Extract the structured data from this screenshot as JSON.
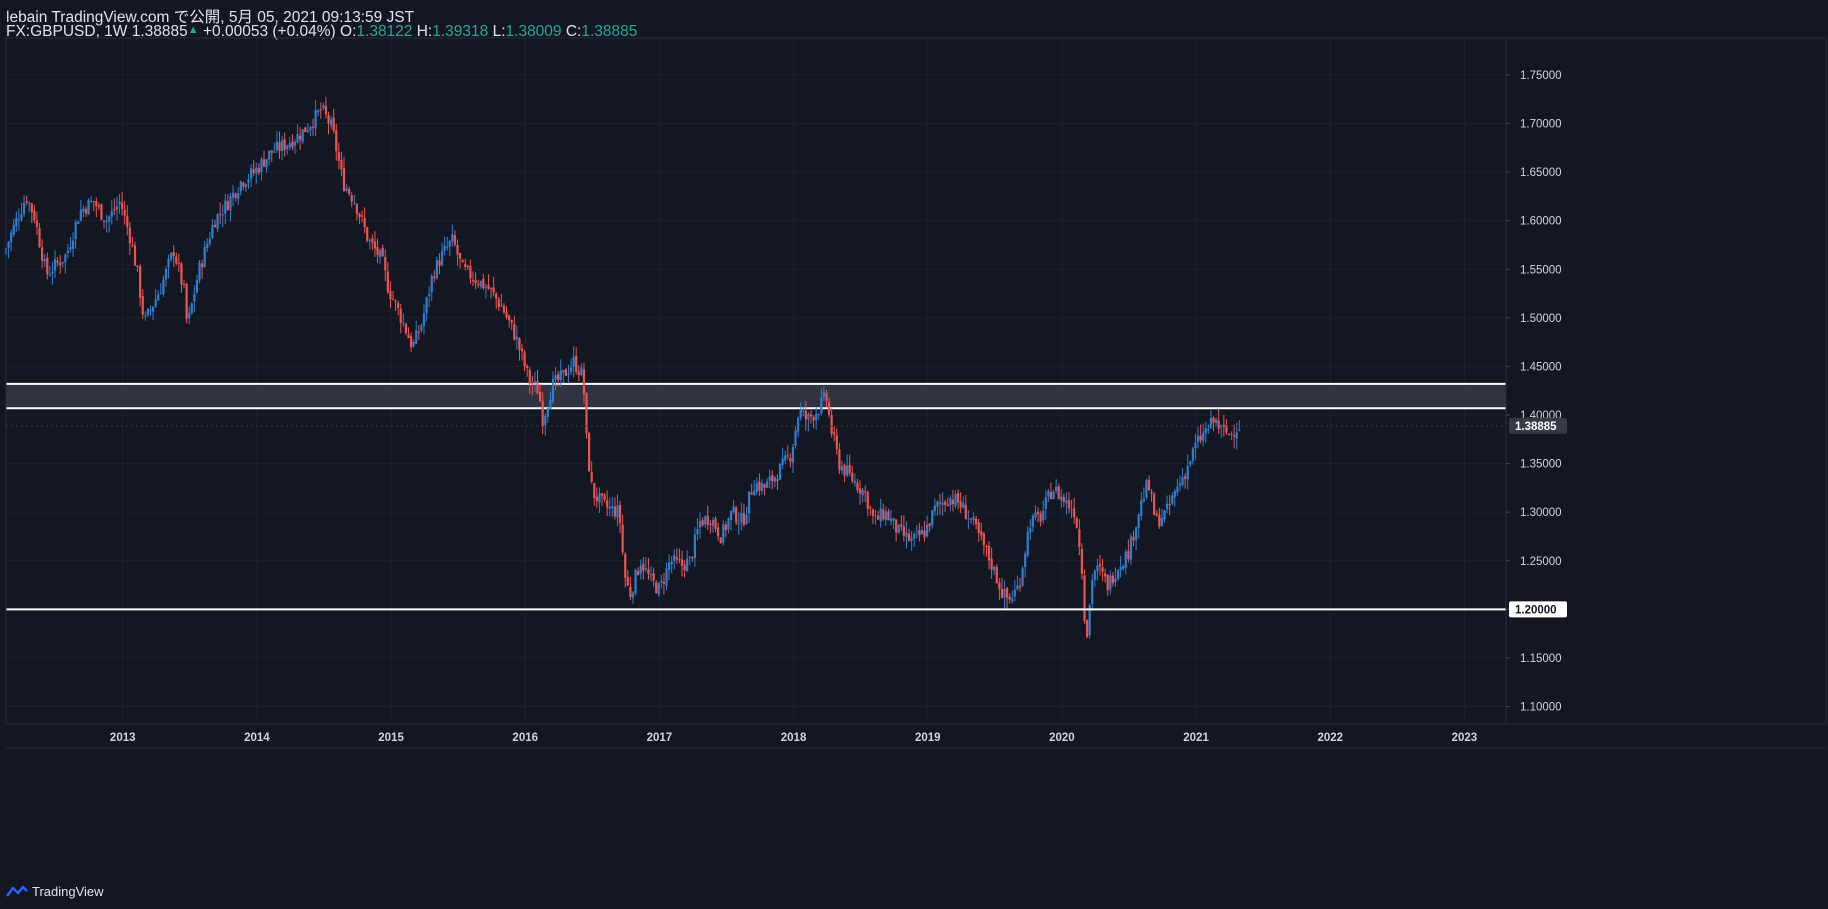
{
  "header": {
    "line1": "lebain TradingView.com で公開, 5月 05, 2021 09:13:59 JST",
    "symbol": "FX:GBPUSD, 1W",
    "last": "1.38885",
    "change": "+0.00053 (+0.04%)",
    "o_label": "O:",
    "o_value": "1.38122",
    "h_label": "H:",
    "h_value": "1.39318",
    "l_label": "L:",
    "l_value": "1.38009",
    "c_label": "C:",
    "c_value": "1.38885"
  },
  "footer": {
    "brand": "TradingView"
  },
  "colors": {
    "background": "#131722",
    "up": "#2f7fd1",
    "down": "#ef5350",
    "zone": "#363a45",
    "line": "#ffffff",
    "text": "#d1d4dc",
    "accent": "#26a69a"
  },
  "chart_data": {
    "type": "candlestick",
    "symbol": "FX:GBPUSD",
    "interval": "1W",
    "x_ticks": [
      "2013",
      "2014",
      "2015",
      "2016",
      "2017",
      "2018",
      "2019",
      "2020",
      "2021",
      "2022",
      "2023"
    ],
    "y_ticks": [
      "1.75000",
      "1.70000",
      "1.65000",
      "1.60000",
      "1.55000",
      "1.50000",
      "1.45000",
      "1.40000",
      "1.35000",
      "1.30000",
      "1.25000",
      "1.20000",
      "1.15000",
      "1.10000"
    ],
    "ylim": [
      1.082,
      1.788
    ],
    "xlim": [
      2012.13,
      2023.31
    ],
    "last_price_label": "1.38885",
    "horizontal_levels": [
      {
        "price": 1.2,
        "label": "1.20000"
      }
    ],
    "zone": {
      "low": 1.407,
      "high": 1.432
    },
    "series_path": [
      [
        2012.13,
        1.565
      ],
      [
        2012.22,
        1.598
      ],
      [
        2012.3,
        1.625
      ],
      [
        2012.36,
        1.605
      ],
      [
        2012.45,
        1.545
      ],
      [
        2012.6,
        1.565
      ],
      [
        2012.7,
        1.61
      ],
      [
        2012.8,
        1.62
      ],
      [
        2012.9,
        1.6
      ],
      [
        2013.0,
        1.62
      ],
      [
        2013.08,
        1.58
      ],
      [
        2013.13,
        1.545
      ],
      [
        2013.18,
        1.495
      ],
      [
        2013.3,
        1.53
      ],
      [
        2013.4,
        1.57
      ],
      [
        2013.48,
        1.525
      ],
      [
        2013.5,
        1.49
      ],
      [
        2013.58,
        1.545
      ],
      [
        2013.7,
        1.6
      ],
      [
        2013.8,
        1.618
      ],
      [
        2013.9,
        1.64
      ],
      [
        2014.0,
        1.65
      ],
      [
        2014.12,
        1.67
      ],
      [
        2014.25,
        1.68
      ],
      [
        2014.35,
        1.69
      ],
      [
        2014.45,
        1.705
      ],
      [
        2014.5,
        1.715
      ],
      [
        2014.58,
        1.695
      ],
      [
        2014.66,
        1.64
      ],
      [
        2014.75,
        1.62
      ],
      [
        2014.85,
        1.58
      ],
      [
        2014.95,
        1.56
      ],
      [
        2015.0,
        1.53
      ],
      [
        2015.08,
        1.505
      ],
      [
        2015.18,
        1.47
      ],
      [
        2015.25,
        1.495
      ],
      [
        2015.33,
        1.545
      ],
      [
        2015.4,
        1.565
      ],
      [
        2015.48,
        1.58
      ],
      [
        2015.55,
        1.55
      ],
      [
        2015.65,
        1.54
      ],
      [
        2015.75,
        1.53
      ],
      [
        2015.85,
        1.51
      ],
      [
        2015.95,
        1.48
      ],
      [
        2016.05,
        1.435
      ],
      [
        2016.12,
        1.425
      ],
      [
        2016.15,
        1.395
      ],
      [
        2016.22,
        1.43
      ],
      [
        2016.3,
        1.44
      ],
      [
        2016.38,
        1.455
      ],
      [
        2016.45,
        1.44
      ],
      [
        2016.48,
        1.365
      ],
      [
        2016.52,
        1.32
      ],
      [
        2016.62,
        1.305
      ],
      [
        2016.72,
        1.3
      ],
      [
        2016.76,
        1.235
      ],
      [
        2016.8,
        1.215
      ],
      [
        2016.88,
        1.25
      ],
      [
        2016.95,
        1.23
      ],
      [
        2017.02,
        1.22
      ],
      [
        2017.1,
        1.25
      ],
      [
        2017.18,
        1.245
      ],
      [
        2017.25,
        1.25
      ],
      [
        2017.32,
        1.29
      ],
      [
        2017.4,
        1.295
      ],
      [
        2017.48,
        1.275
      ],
      [
        2017.56,
        1.3
      ],
      [
        2017.64,
        1.29
      ],
      [
        2017.72,
        1.33
      ],
      [
        2017.8,
        1.325
      ],
      [
        2017.9,
        1.34
      ],
      [
        2018.0,
        1.36
      ],
      [
        2018.06,
        1.405
      ],
      [
        2018.12,
        1.395
      ],
      [
        2018.2,
        1.405
      ],
      [
        2018.26,
        1.42
      ],
      [
        2018.3,
        1.385
      ],
      [
        2018.36,
        1.35
      ],
      [
        2018.45,
        1.335
      ],
      [
        2018.55,
        1.32
      ],
      [
        2018.62,
        1.29
      ],
      [
        2018.7,
        1.3
      ],
      [
        2018.8,
        1.28
      ],
      [
        2018.9,
        1.27
      ],
      [
        2019.0,
        1.28
      ],
      [
        2019.08,
        1.305
      ],
      [
        2019.18,
        1.315
      ],
      [
        2019.25,
        1.31
      ],
      [
        2019.35,
        1.29
      ],
      [
        2019.42,
        1.27
      ],
      [
        2019.5,
        1.245
      ],
      [
        2019.58,
        1.215
      ],
      [
        2019.63,
        1.21
      ],
      [
        2019.7,
        1.225
      ],
      [
        2019.78,
        1.29
      ],
      [
        2019.86,
        1.295
      ],
      [
        2019.95,
        1.325
      ],
      [
        2020.05,
        1.31
      ],
      [
        2020.12,
        1.3
      ],
      [
        2020.17,
        1.24
      ],
      [
        2020.2,
        1.165
      ],
      [
        2020.25,
        1.24
      ],
      [
        2020.3,
        1.24
      ],
      [
        2020.36,
        1.225
      ],
      [
        2020.44,
        1.245
      ],
      [
        2020.52,
        1.26
      ],
      [
        2020.6,
        1.305
      ],
      [
        2020.66,
        1.33
      ],
      [
        2020.72,
        1.29
      ],
      [
        2020.8,
        1.3
      ],
      [
        2020.86,
        1.32
      ],
      [
        2020.95,
        1.345
      ],
      [
        2021.02,
        1.37
      ],
      [
        2021.1,
        1.385
      ],
      [
        2021.16,
        1.395
      ],
      [
        2021.2,
        1.385
      ],
      [
        2021.27,
        1.38
      ],
      [
        2021.33,
        1.389
      ]
    ]
  }
}
